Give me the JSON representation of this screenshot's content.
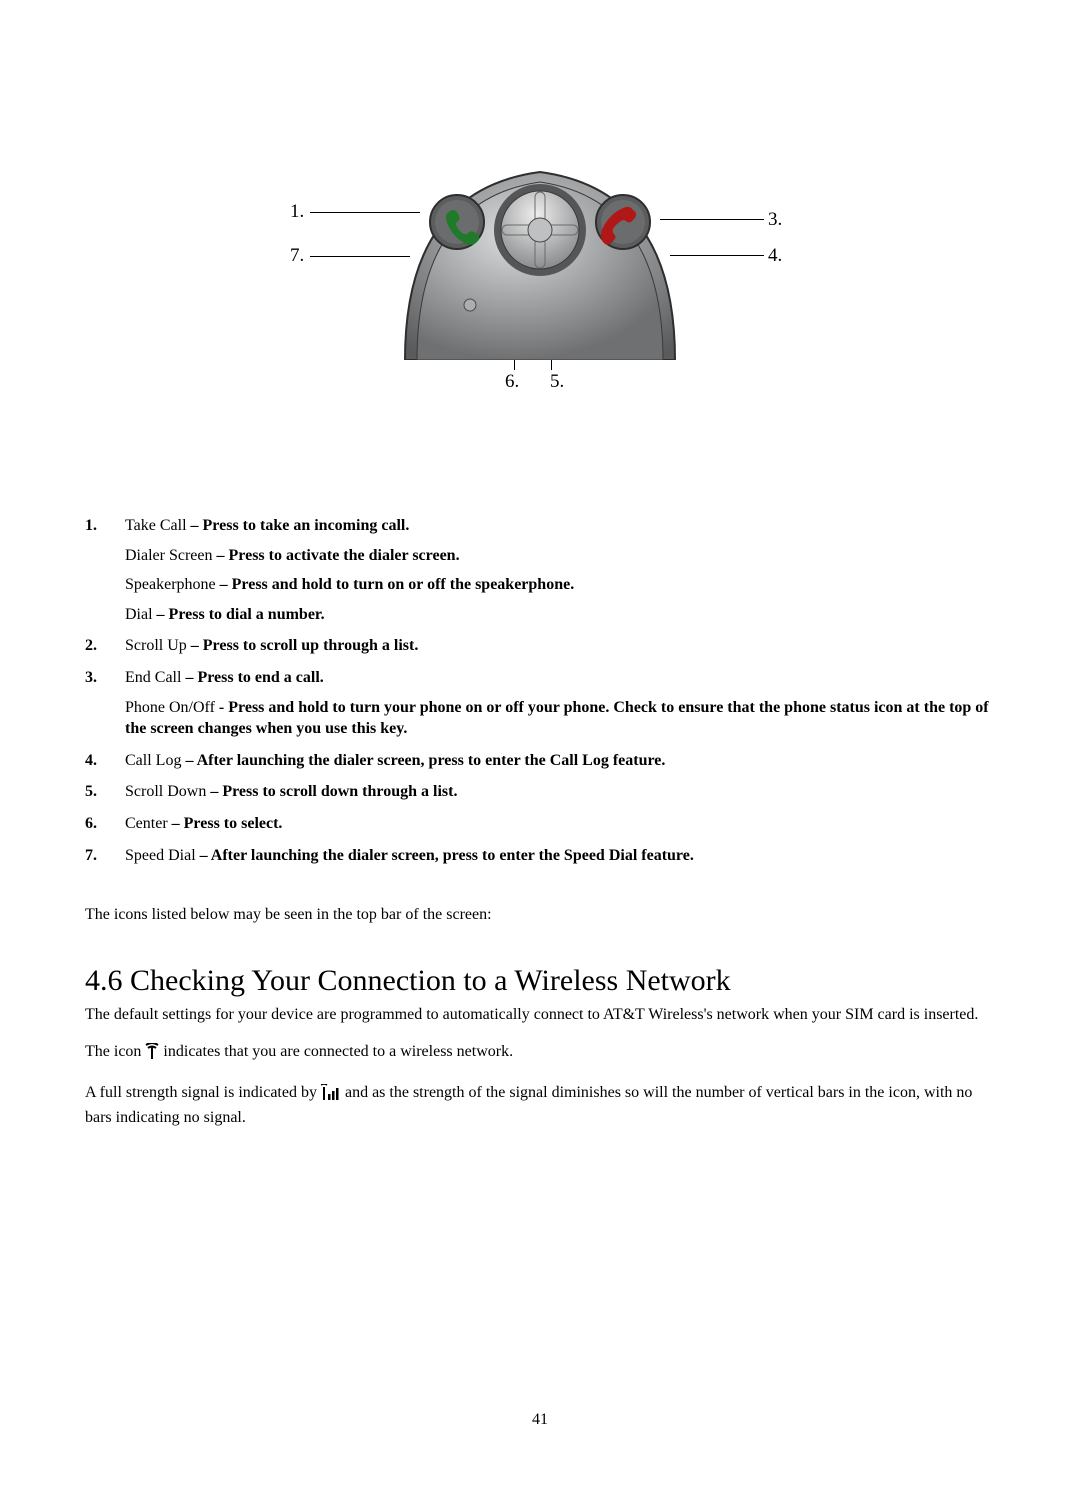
{
  "diagram": {
    "callouts": {
      "c1": "1.",
      "c3": "3.",
      "c4": "4.",
      "c5": "5.",
      "c6": "6.",
      "c7": "7."
    }
  },
  "features": [
    {
      "num": "1.",
      "lines": [
        {
          "label": "Take Call",
          "sep": " – ",
          "desc": "Press to take an incoming call."
        },
        {
          "label": "Dialer Screen",
          "sep": " – ",
          "desc": "Press to activate the dialer screen."
        },
        {
          "label": "Speakerphone",
          "sep": " – ",
          "desc": "Press and hold to turn on or off the speakerphone."
        },
        {
          "label": "Dial",
          "sep": " – ",
          "desc": "Press to dial a number."
        }
      ]
    },
    {
      "num": "2.",
      "lines": [
        {
          "label": "Scroll Up",
          "sep": " – ",
          "desc": "Press to scroll up through a list."
        }
      ]
    },
    {
      "num": "3.",
      "lines": [
        {
          "label": "End Call",
          "sep": " – ",
          "desc": "Press to end a call."
        },
        {
          "label": "Phone On/Off",
          "sep": " - ",
          "desc": "Press and hold to turn your phone on or off your phone.  Check to ensure that the phone status icon at the top of the screen changes when you use this key."
        }
      ]
    },
    {
      "num": "4.",
      "lines": [
        {
          "label": "Call Log",
          "sep": " – ",
          "desc": "After launching the dialer screen, press to enter the Call Log feature."
        }
      ]
    },
    {
      "num": "5.",
      "lines": [
        {
          "label": "Scroll Down",
          "sep": " – ",
          "desc": "Press to scroll down through a list."
        }
      ]
    },
    {
      "num": "6.",
      "lines": [
        {
          "label": "Center",
          "sep": " – ",
          "desc": "Press to select."
        }
      ]
    },
    {
      "num": "7.",
      "lines": [
        {
          "label": "Speed Dial",
          "sep": " – ",
          "desc": "After launching the dialer screen, press to enter the Speed Dial feature."
        }
      ]
    }
  ],
  "icons_intro": "The icons listed below may be seen in the top bar of the screen:",
  "section_heading": "4.6 Checking Your Connection to a Wireless Network",
  "conn_p1": "The default settings for your device are programmed to automatically connect to AT&T Wireless's network when your SIM card is inserted.",
  "conn_p2_pre": "The icon ",
  "conn_p2_post": " indicates that you are connected to a wireless network.",
  "conn_p3_pre": "A full strength signal is indicated by ",
  "conn_p3_post": " and as the strength of the signal diminishes so will the number of vertical bars in the icon, with no bars indicating no signal.",
  "page_number": "41"
}
